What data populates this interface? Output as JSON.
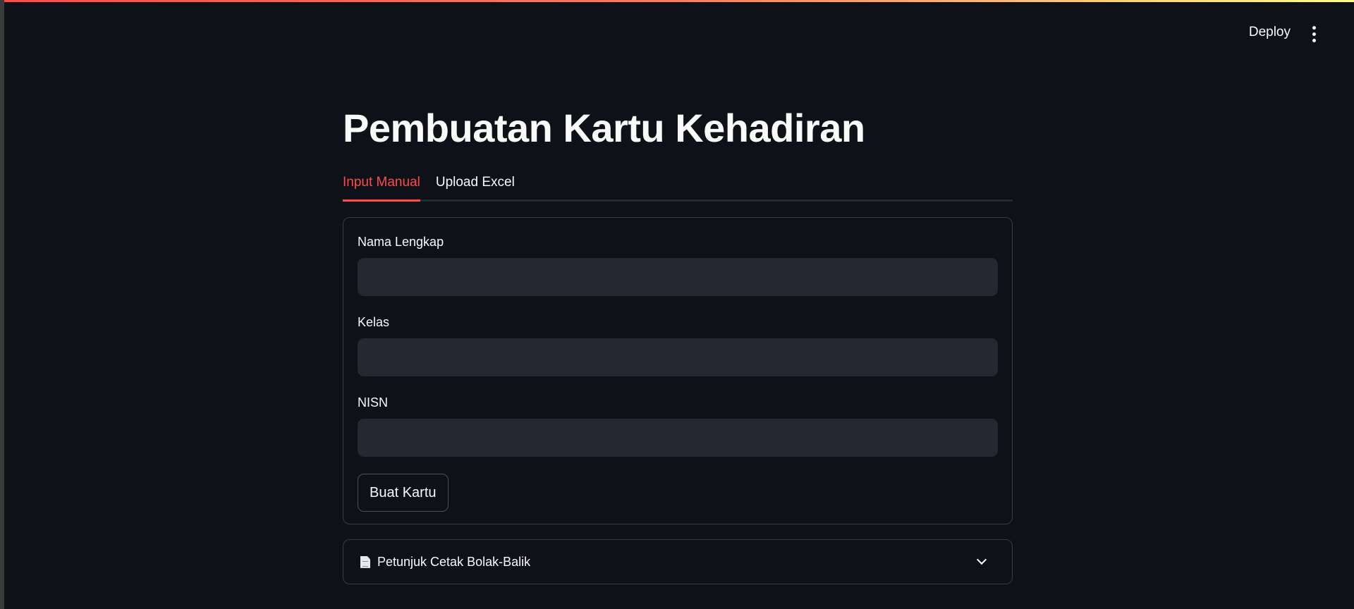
{
  "header": {
    "deploy_label": "Deploy",
    "menu_icon": "kebab-menu-icon"
  },
  "main": {
    "title": "Pembuatan Kartu Kehadiran",
    "tabs": [
      {
        "label": "Input Manual",
        "active": true
      },
      {
        "label": "Upload Excel",
        "active": false
      }
    ],
    "form": {
      "fields": [
        {
          "label": "Nama Lengkap",
          "value": ""
        },
        {
          "label": "Kelas",
          "value": ""
        },
        {
          "label": "NISN",
          "value": ""
        }
      ],
      "submit_label": "Buat Kartu"
    },
    "expander": {
      "icon": "document-icon",
      "label": "Petunjuk Cetak Bolak-Balik",
      "expanded": false
    }
  },
  "theme": {
    "background": "#0e1117",
    "accent": "#ff4b4b",
    "input_bg": "#262730",
    "text": "#fafafa"
  }
}
